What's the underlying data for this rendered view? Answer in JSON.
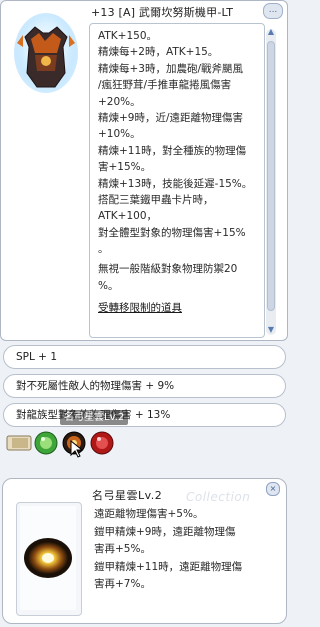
{
  "item": {
    "title": "+13 [A] 武爾坎努斯機甲-LT",
    "title_button": "...",
    "description_lines": [
      "ATK+150。",
      "精煉每+2時，ATK+15。",
      "精煉每+3時，加農砲/戰斧颶風",
      "/瘋狂野茸/手推車龍捲風傷害",
      "+20%。",
      "精煉+9時，近/遠距離物理傷害",
      "+10%。",
      "精煉+11時，對全種族的物理傷",
      "害+15%。",
      "精煉+13時，技能後延遲-15%。",
      "搭配三葉鐵甲蟲卡片時，",
      "ATK+100，",
      "對全體型對象的物理傷害+15%",
      "。",
      "無視一般階級對象物理防禦20",
      "%。"
    ],
    "restriction_link": "受轉移限制的道具"
  },
  "scrollbar": {
    "up": "▲",
    "down": "▼"
  },
  "options": [
    "SPL + 1",
    "對不死屬性敵人的物理傷害 + 9%",
    "對龍族型對象的物理傷害 + 13%"
  ],
  "cards": {
    "tooltip": "名弓星雲Lv.2",
    "slots": [
      "slot-card-icon",
      "green-orb-card",
      "nebula-card",
      "red-orb-card"
    ]
  },
  "card_window": {
    "title": "名弓星雲Lv.2",
    "watermark": "Collection",
    "close": "×",
    "description_lines": [
      "遠距離物理傷害+5%。",
      "鎧甲精煉+9時，遠距離物理傷",
      "害再+5%。",
      "鎧甲精煉+11時，遠距離物理傷",
      "害再+7%。"
    ]
  },
  "colors": {
    "window_border": "#aeb7c3",
    "accent": "#4a6a9a",
    "background": "#eef2f7"
  }
}
